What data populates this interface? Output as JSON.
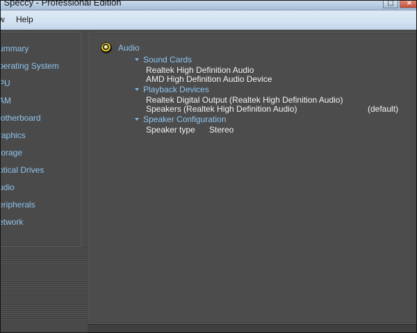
{
  "window": {
    "title": "m Speccy - Professional Edition"
  },
  "menu": {
    "view_label": "w",
    "help_label": "Help"
  },
  "sidebar": {
    "items": [
      {
        "label": "ummary"
      },
      {
        "label": "perating System"
      },
      {
        "label": "PU"
      },
      {
        "label": "AM"
      },
      {
        "label": "lotherboard"
      },
      {
        "label": "raphics"
      },
      {
        "label": "torage"
      },
      {
        "label": "ptical Drives"
      },
      {
        "label": "udio"
      },
      {
        "label": "eripherals"
      },
      {
        "label": "etwork"
      }
    ]
  },
  "content": {
    "section_title": "Audio",
    "icons": {
      "section": "audio-icon",
      "expand": "chevron-down-icon"
    },
    "groups": [
      {
        "title": "Sound Cards",
        "items": [
          "Realtek High Definition Audio",
          "AMD High Definition Audio Device"
        ]
      },
      {
        "title": "Playback Devices",
        "items": [
          "Realtek Digital Output (Realtek High Definition Audio)",
          "Speakers (Realtek High Definition Audio)"
        ],
        "default_label": "(default)"
      },
      {
        "title": "Speaker Configuration",
        "fields": [
          {
            "label": "Speaker type",
            "value": "Stereo"
          }
        ]
      }
    ]
  },
  "colors": {
    "background": "#4a4a4a",
    "accent_text": "#8ec5ef",
    "primary_text": "#f4f4f4",
    "menu_bar": "#d4e2f1"
  }
}
